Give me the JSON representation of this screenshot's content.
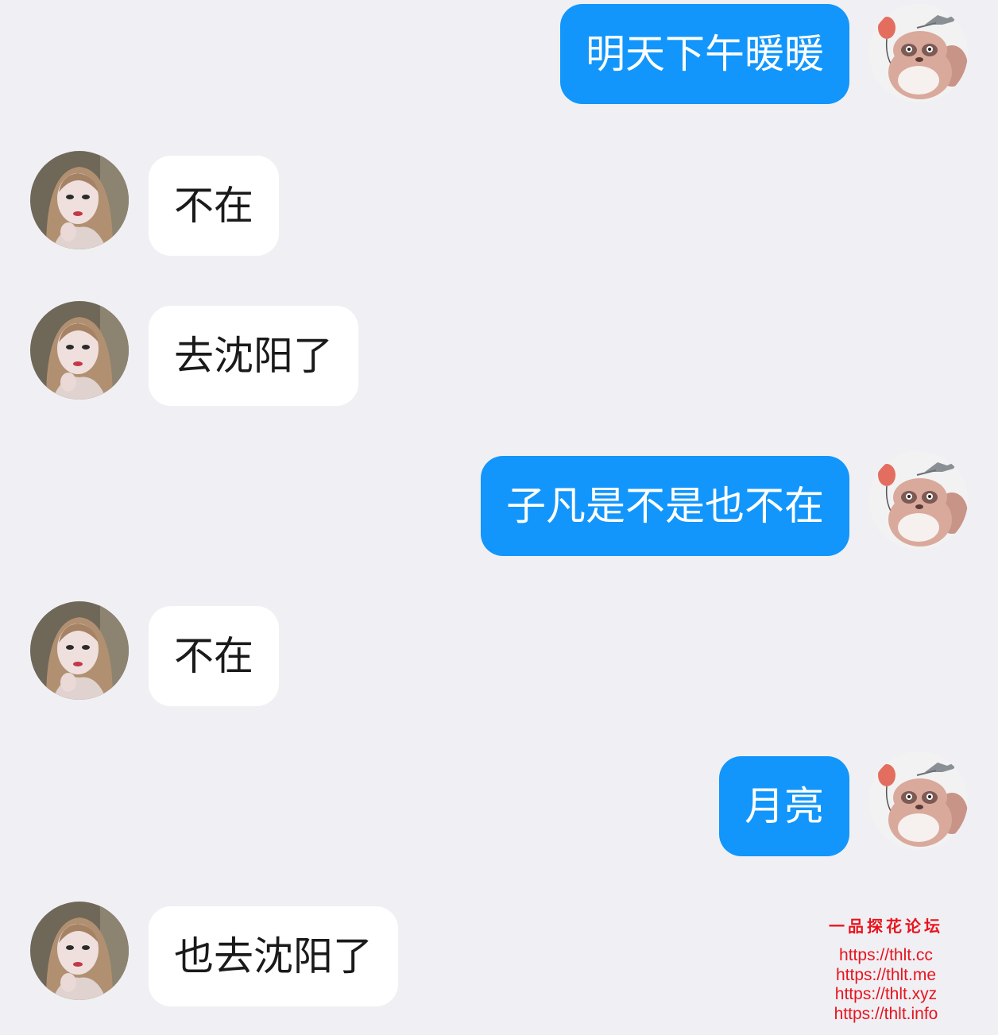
{
  "chat": {
    "messages": [
      {
        "side": "out",
        "text": "明天下午暖暖"
      },
      {
        "side": "in",
        "text": "不在"
      },
      {
        "side": "in",
        "text": "去沈阳了"
      },
      {
        "side": "out",
        "text": "子凡是不是也不在"
      },
      {
        "side": "in",
        "text": "不在"
      },
      {
        "side": "out",
        "text": "月亮"
      },
      {
        "side": "in",
        "text": "也去沈阳了"
      }
    ]
  },
  "avatars": {
    "self": "raccoon-balloon-avatar",
    "contact": "woman-portrait-avatar"
  },
  "watermark": {
    "title": "一品探花论坛",
    "links": [
      "https://thlt.cc",
      "https://thlt.me",
      "https://thlt.xyz",
      "https://thlt.info"
    ]
  },
  "colors": {
    "background": "#f0f0f4",
    "outgoing_bubble": "#1296fb",
    "incoming_bubble": "#ffffff",
    "watermark": "#e8141e"
  }
}
